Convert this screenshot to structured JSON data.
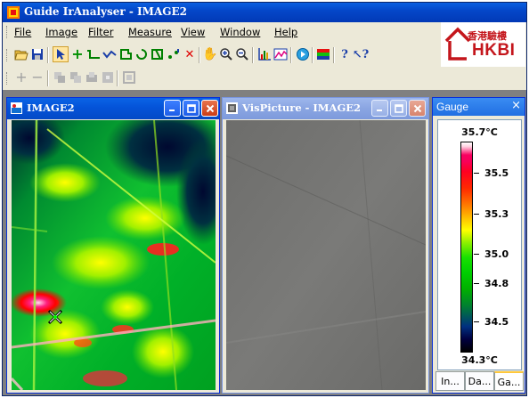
{
  "window": {
    "title": "Guide IrAnalyser - IMAGE2"
  },
  "menu": [
    "File",
    "Image",
    "Filter",
    "Measure",
    "View",
    "Window",
    "Help"
  ],
  "logo": {
    "chinese": "香港驗樓",
    "english": "HKBI",
    "color": "#c4161c"
  },
  "toolbar1": [
    "open-icon",
    "save-icon",
    "pointer-icon",
    "crosshair-icon",
    "line-icon",
    "polyline-icon",
    "polygon-icon",
    "freehand-icon",
    "rectangle-icon",
    "spot-move-icon",
    "delete-icon",
    "pan-icon",
    "zoom-in-icon",
    "zoom-out-icon",
    "histogram-icon",
    "profile-icon",
    "play-icon",
    "palette-icon",
    "help-icon",
    "context-help-icon"
  ],
  "toolbar2": [
    "add-icon",
    "remove-icon",
    "copy-icon",
    "copy2-icon",
    "merge-icon",
    "split-icon",
    "fit-icon"
  ],
  "image_window": {
    "title": "IMAGE2"
  },
  "vis_window": {
    "title": "VisPicture - IMAGE2"
  },
  "gauge": {
    "title": "Gauge",
    "close": "×",
    "max": "35.7°C",
    "min": "34.3°C",
    "ticks": [
      "35.5",
      "35.3",
      "35.0",
      "34.8",
      "34.5"
    ],
    "tabs": [
      "In...",
      "Da...",
      "Ga..."
    ]
  }
}
